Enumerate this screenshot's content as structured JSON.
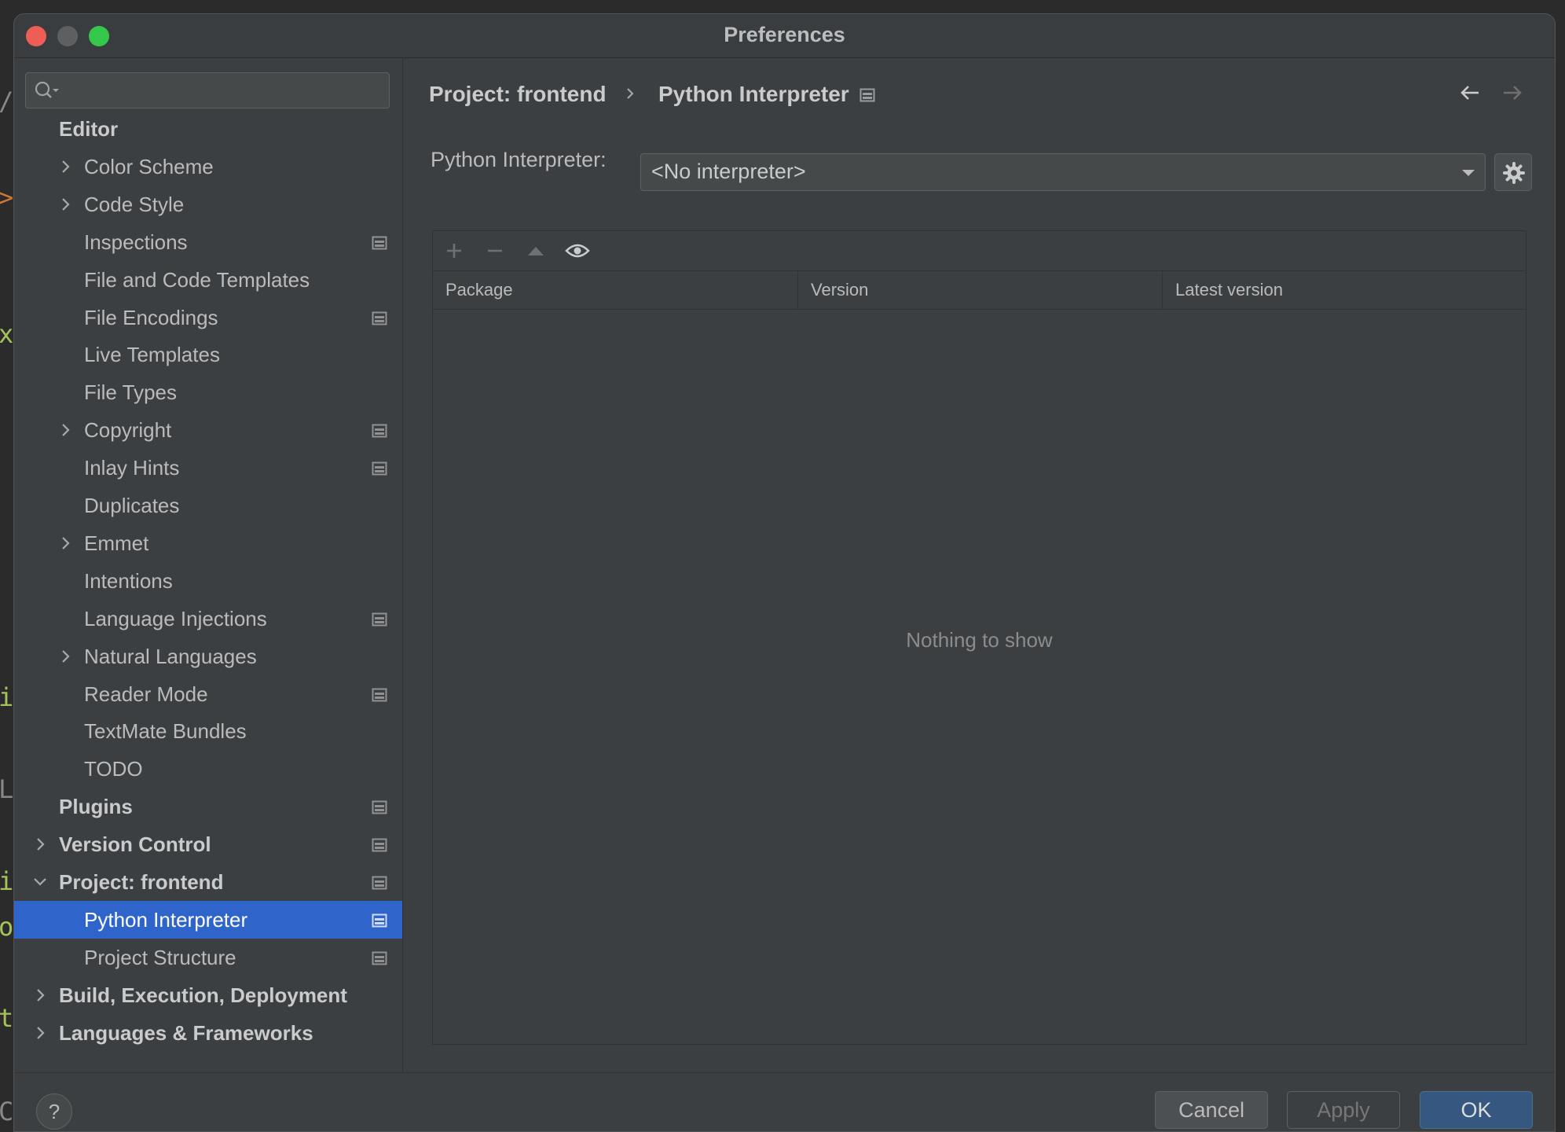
{
  "window": {
    "title": "Preferences"
  },
  "search": {
    "placeholder": ""
  },
  "sidebar": {
    "items": [
      {
        "label": "Editor",
        "level": 0,
        "bold": true,
        "chevron": "none",
        "project_icon": false
      },
      {
        "label": "Color Scheme",
        "level": 1,
        "bold": false,
        "chevron": "right",
        "project_icon": false
      },
      {
        "label": "Code Style",
        "level": 1,
        "bold": false,
        "chevron": "right",
        "project_icon": false
      },
      {
        "label": "Inspections",
        "level": 1,
        "bold": false,
        "chevron": "none",
        "project_icon": true
      },
      {
        "label": "File and Code Templates",
        "level": 1,
        "bold": false,
        "chevron": "none",
        "project_icon": false
      },
      {
        "label": "File Encodings",
        "level": 1,
        "bold": false,
        "chevron": "none",
        "project_icon": true
      },
      {
        "label": "Live Templates",
        "level": 1,
        "bold": false,
        "chevron": "none",
        "project_icon": false
      },
      {
        "label": "File Types",
        "level": 1,
        "bold": false,
        "chevron": "none",
        "project_icon": false
      },
      {
        "label": "Copyright",
        "level": 1,
        "bold": false,
        "chevron": "right",
        "project_icon": true
      },
      {
        "label": "Inlay Hints",
        "level": 1,
        "bold": false,
        "chevron": "none",
        "project_icon": true
      },
      {
        "label": "Duplicates",
        "level": 1,
        "bold": false,
        "chevron": "none",
        "project_icon": false
      },
      {
        "label": "Emmet",
        "level": 1,
        "bold": false,
        "chevron": "right",
        "project_icon": false
      },
      {
        "label": "Intentions",
        "level": 1,
        "bold": false,
        "chevron": "none",
        "project_icon": false
      },
      {
        "label": "Language Injections",
        "level": 1,
        "bold": false,
        "chevron": "none",
        "project_icon": true
      },
      {
        "label": "Natural Languages",
        "level": 1,
        "bold": false,
        "chevron": "right",
        "project_icon": false
      },
      {
        "label": "Reader Mode",
        "level": 1,
        "bold": false,
        "chevron": "none",
        "project_icon": true
      },
      {
        "label": "TextMate Bundles",
        "level": 1,
        "bold": false,
        "chevron": "none",
        "project_icon": false
      },
      {
        "label": "TODO",
        "level": 1,
        "bold": false,
        "chevron": "none",
        "project_icon": false
      },
      {
        "label": "Plugins",
        "level": 0,
        "bold": true,
        "chevron": "none",
        "project_icon": true
      },
      {
        "label": "Version Control",
        "level": 0,
        "bold": true,
        "chevron": "right",
        "project_icon": true
      },
      {
        "label": "Project: frontend",
        "level": 0,
        "bold": true,
        "chevron": "down",
        "project_icon": true
      },
      {
        "label": "Python Interpreter",
        "level": 1,
        "bold": false,
        "chevron": "none",
        "project_icon": true,
        "selected": true
      },
      {
        "label": "Project Structure",
        "level": 1,
        "bold": false,
        "chevron": "none",
        "project_icon": true
      },
      {
        "label": "Build, Execution, Deployment",
        "level": 0,
        "bold": true,
        "chevron": "right",
        "project_icon": false
      },
      {
        "label": "Languages & Frameworks",
        "level": 0,
        "bold": true,
        "chevron": "right",
        "project_icon": false
      }
    ]
  },
  "breadcrumb": {
    "project": "Project: frontend",
    "page": "Python Interpreter"
  },
  "interpreter": {
    "label": "Python Interpreter:",
    "value": "<No interpreter>"
  },
  "packages": {
    "columns": [
      "Package",
      "Version",
      "Latest version"
    ],
    "rows": [],
    "empty_text": "Nothing to show"
  },
  "footer": {
    "help": "?",
    "cancel": "Cancel",
    "apply": "Apply",
    "ok": "OK"
  },
  "colors": {
    "selection": "#2f65ca",
    "ok_button": "#365880",
    "background": "#3c3f41"
  }
}
